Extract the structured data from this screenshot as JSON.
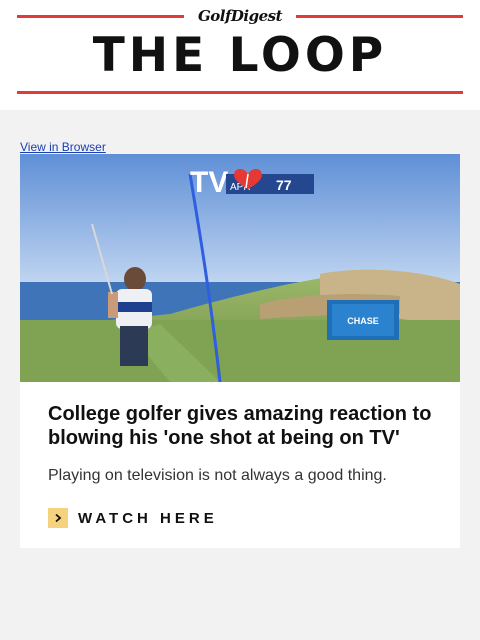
{
  "header": {
    "brand": "GolfDigest",
    "masthead": "THE LOOP"
  },
  "view_in_browser": "View in Browser",
  "article": {
    "hero_overlay": {
      "title_fragment": "TV",
      "tag": "APR",
      "number": "77",
      "sponsor": "CHASE"
    },
    "title": "College golfer gives amazing reaction to blowing his 'one shot at being on TV'",
    "description": "Playing on television is not always a good thing.",
    "cta": "WATCH HERE"
  },
  "colors": {
    "accent_rule": "#e03a3a",
    "cta_icon_bg": "#f6d27e",
    "link": "#1a3fb5"
  }
}
